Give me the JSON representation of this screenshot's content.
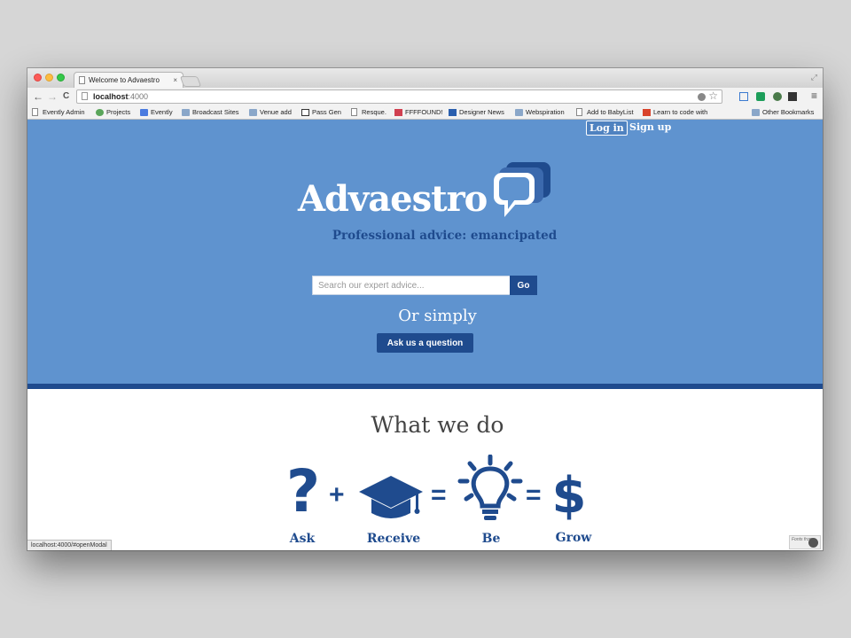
{
  "browser": {
    "tab_title": "Welcome to Advaestro",
    "tab_close": "×",
    "url_host": "localhost",
    "url_port": ":4000",
    "back": "←",
    "forward": "→",
    "reload": "C",
    "menu": "≡",
    "star": "☆",
    "expand": "⤢"
  },
  "bookmarks": [
    {
      "label": "Evently Admin",
      "icon": "page"
    },
    {
      "label": "Projects",
      "icon": "green"
    },
    {
      "label": "Evently",
      "icon": "g"
    },
    {
      "label": "Broadcast Sites",
      "icon": "folder"
    },
    {
      "label": "Venue add",
      "icon": "folder"
    },
    {
      "label": "Pass Gen",
      "icon": "r"
    },
    {
      "label": "Resque.",
      "icon": "page"
    },
    {
      "label": "FFFFOUND!",
      "icon": "heart"
    },
    {
      "label": "Designer News",
      "icon": "dn"
    },
    {
      "label": "Webspiration",
      "icon": "folder"
    },
    {
      "label": "Add to BabyList",
      "icon": "page"
    },
    {
      "label": "Learn to code with",
      "icon": "s"
    },
    {
      "label": "Other Bookmarks",
      "icon": "folder"
    }
  ],
  "nav": {
    "login": "Log in",
    "signup": "Sign up"
  },
  "hero": {
    "logo": "Advaestro",
    "tagline": "Professional advice: emancipated",
    "search_placeholder": "Search our expert advice...",
    "search_button": "Go",
    "or_simply": "Or simply",
    "ask_button": "Ask us a question"
  },
  "what_we_do": {
    "title": "What we do",
    "steps": [
      {
        "label": "Ask",
        "icon": "question-icon"
      },
      {
        "label": "Receive",
        "icon": "graduation-cap-icon"
      },
      {
        "label": "Be",
        "icon": "lightbulb-icon"
      },
      {
        "label": "Grow",
        "icon": "dollar-icon"
      }
    ],
    "operators": [
      "+",
      "=",
      "="
    ]
  },
  "status_url": "localhost:4000/#openModal",
  "fonts_badge": "Fonts from",
  "colors": {
    "hero_bg": "#5f93cf",
    "brand_dark": "#1f4b8e"
  }
}
